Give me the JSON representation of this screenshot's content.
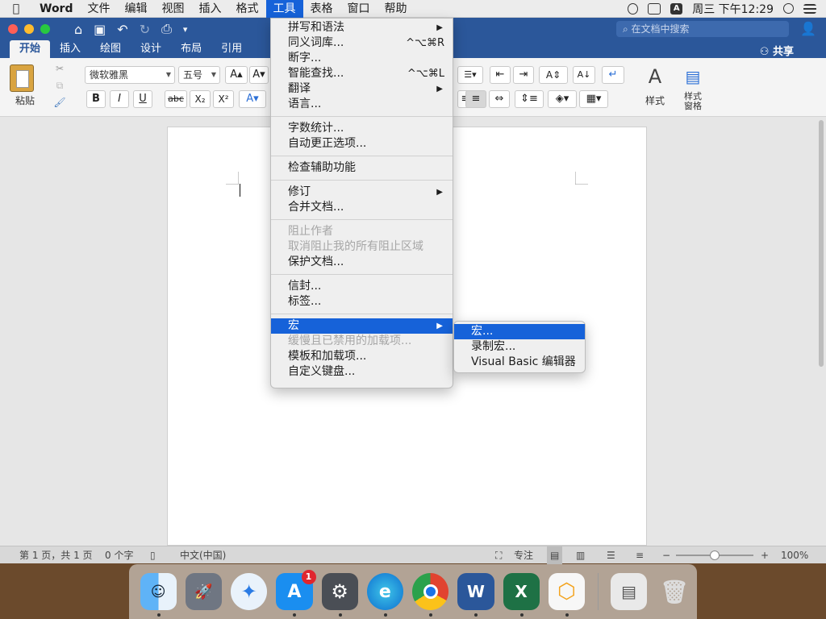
{
  "menubar": {
    "app_name": "Word",
    "items": [
      "文件",
      "编辑",
      "视图",
      "插入",
      "格式",
      "工具",
      "表格",
      "窗口",
      "帮助"
    ],
    "active_item": "工具",
    "clock": "周三 下午12:29",
    "input_method": "A"
  },
  "titlebar": {
    "search_placeholder": "在文档中搜索"
  },
  "tabs": [
    "开始",
    "插入",
    "绘图",
    "设计",
    "布局",
    "引用"
  ],
  "active_tab": "开始",
  "share_label": "共享",
  "ribbon": {
    "paste_label": "粘贴",
    "font_name": "微软雅黑",
    "font_size": "五号",
    "bold": "B",
    "italic": "I",
    "underline": "U",
    "strike": "abc",
    "subscript": "X₂",
    "superscript": "X²",
    "styles_label": "样式",
    "styles_pane_label": "样式\n窗格"
  },
  "tools_menu": {
    "groups": [
      [
        {
          "label": "拼写和语法",
          "submenu": true
        },
        {
          "label": "同义词库...",
          "shortcut": "^⌥⌘R"
        },
        {
          "label": "断字..."
        },
        {
          "label": "智能查找...",
          "shortcut": "^⌥⌘L"
        },
        {
          "label": "翻译",
          "submenu": true
        },
        {
          "label": "语言..."
        }
      ],
      [
        {
          "label": "字数统计..."
        },
        {
          "label": "自动更正选项..."
        }
      ],
      [
        {
          "label": "检查辅助功能"
        }
      ],
      [
        {
          "label": "修订",
          "submenu": true
        },
        {
          "label": "合并文档..."
        }
      ],
      [
        {
          "label": "阻止作者",
          "disabled": true
        },
        {
          "label": "取消阻止我的所有阻止区域",
          "disabled": true
        },
        {
          "label": "保护文档..."
        }
      ],
      [
        {
          "label": "信封..."
        },
        {
          "label": "标签..."
        }
      ],
      [
        {
          "label": "宏",
          "submenu": true,
          "selected": true
        },
        {
          "label": "缓慢且已禁用的加载项...",
          "disabled": true
        },
        {
          "label": "模板和加载项..."
        },
        {
          "label": "自定义键盘..."
        }
      ]
    ]
  },
  "macro_submenu": [
    {
      "label": "宏...",
      "selected": true
    },
    {
      "label": "录制宏..."
    },
    {
      "label": "Visual Basic 编辑器"
    }
  ],
  "status": {
    "page": "第 1 页，共 1 页",
    "words": "0 个字",
    "language": "中文(中国)",
    "focus": "专注",
    "zoom": "100%",
    "zoom_minus": "−",
    "zoom_plus": "+"
  },
  "dock": {
    "apps": [
      "Finder",
      "Launchpad",
      "Safari",
      "App Store",
      "System Preferences",
      "Edge",
      "Chrome",
      "Word",
      "Excel",
      "Sketch-like",
      "Downloads",
      "Trash"
    ],
    "appstore_badge": "1"
  }
}
